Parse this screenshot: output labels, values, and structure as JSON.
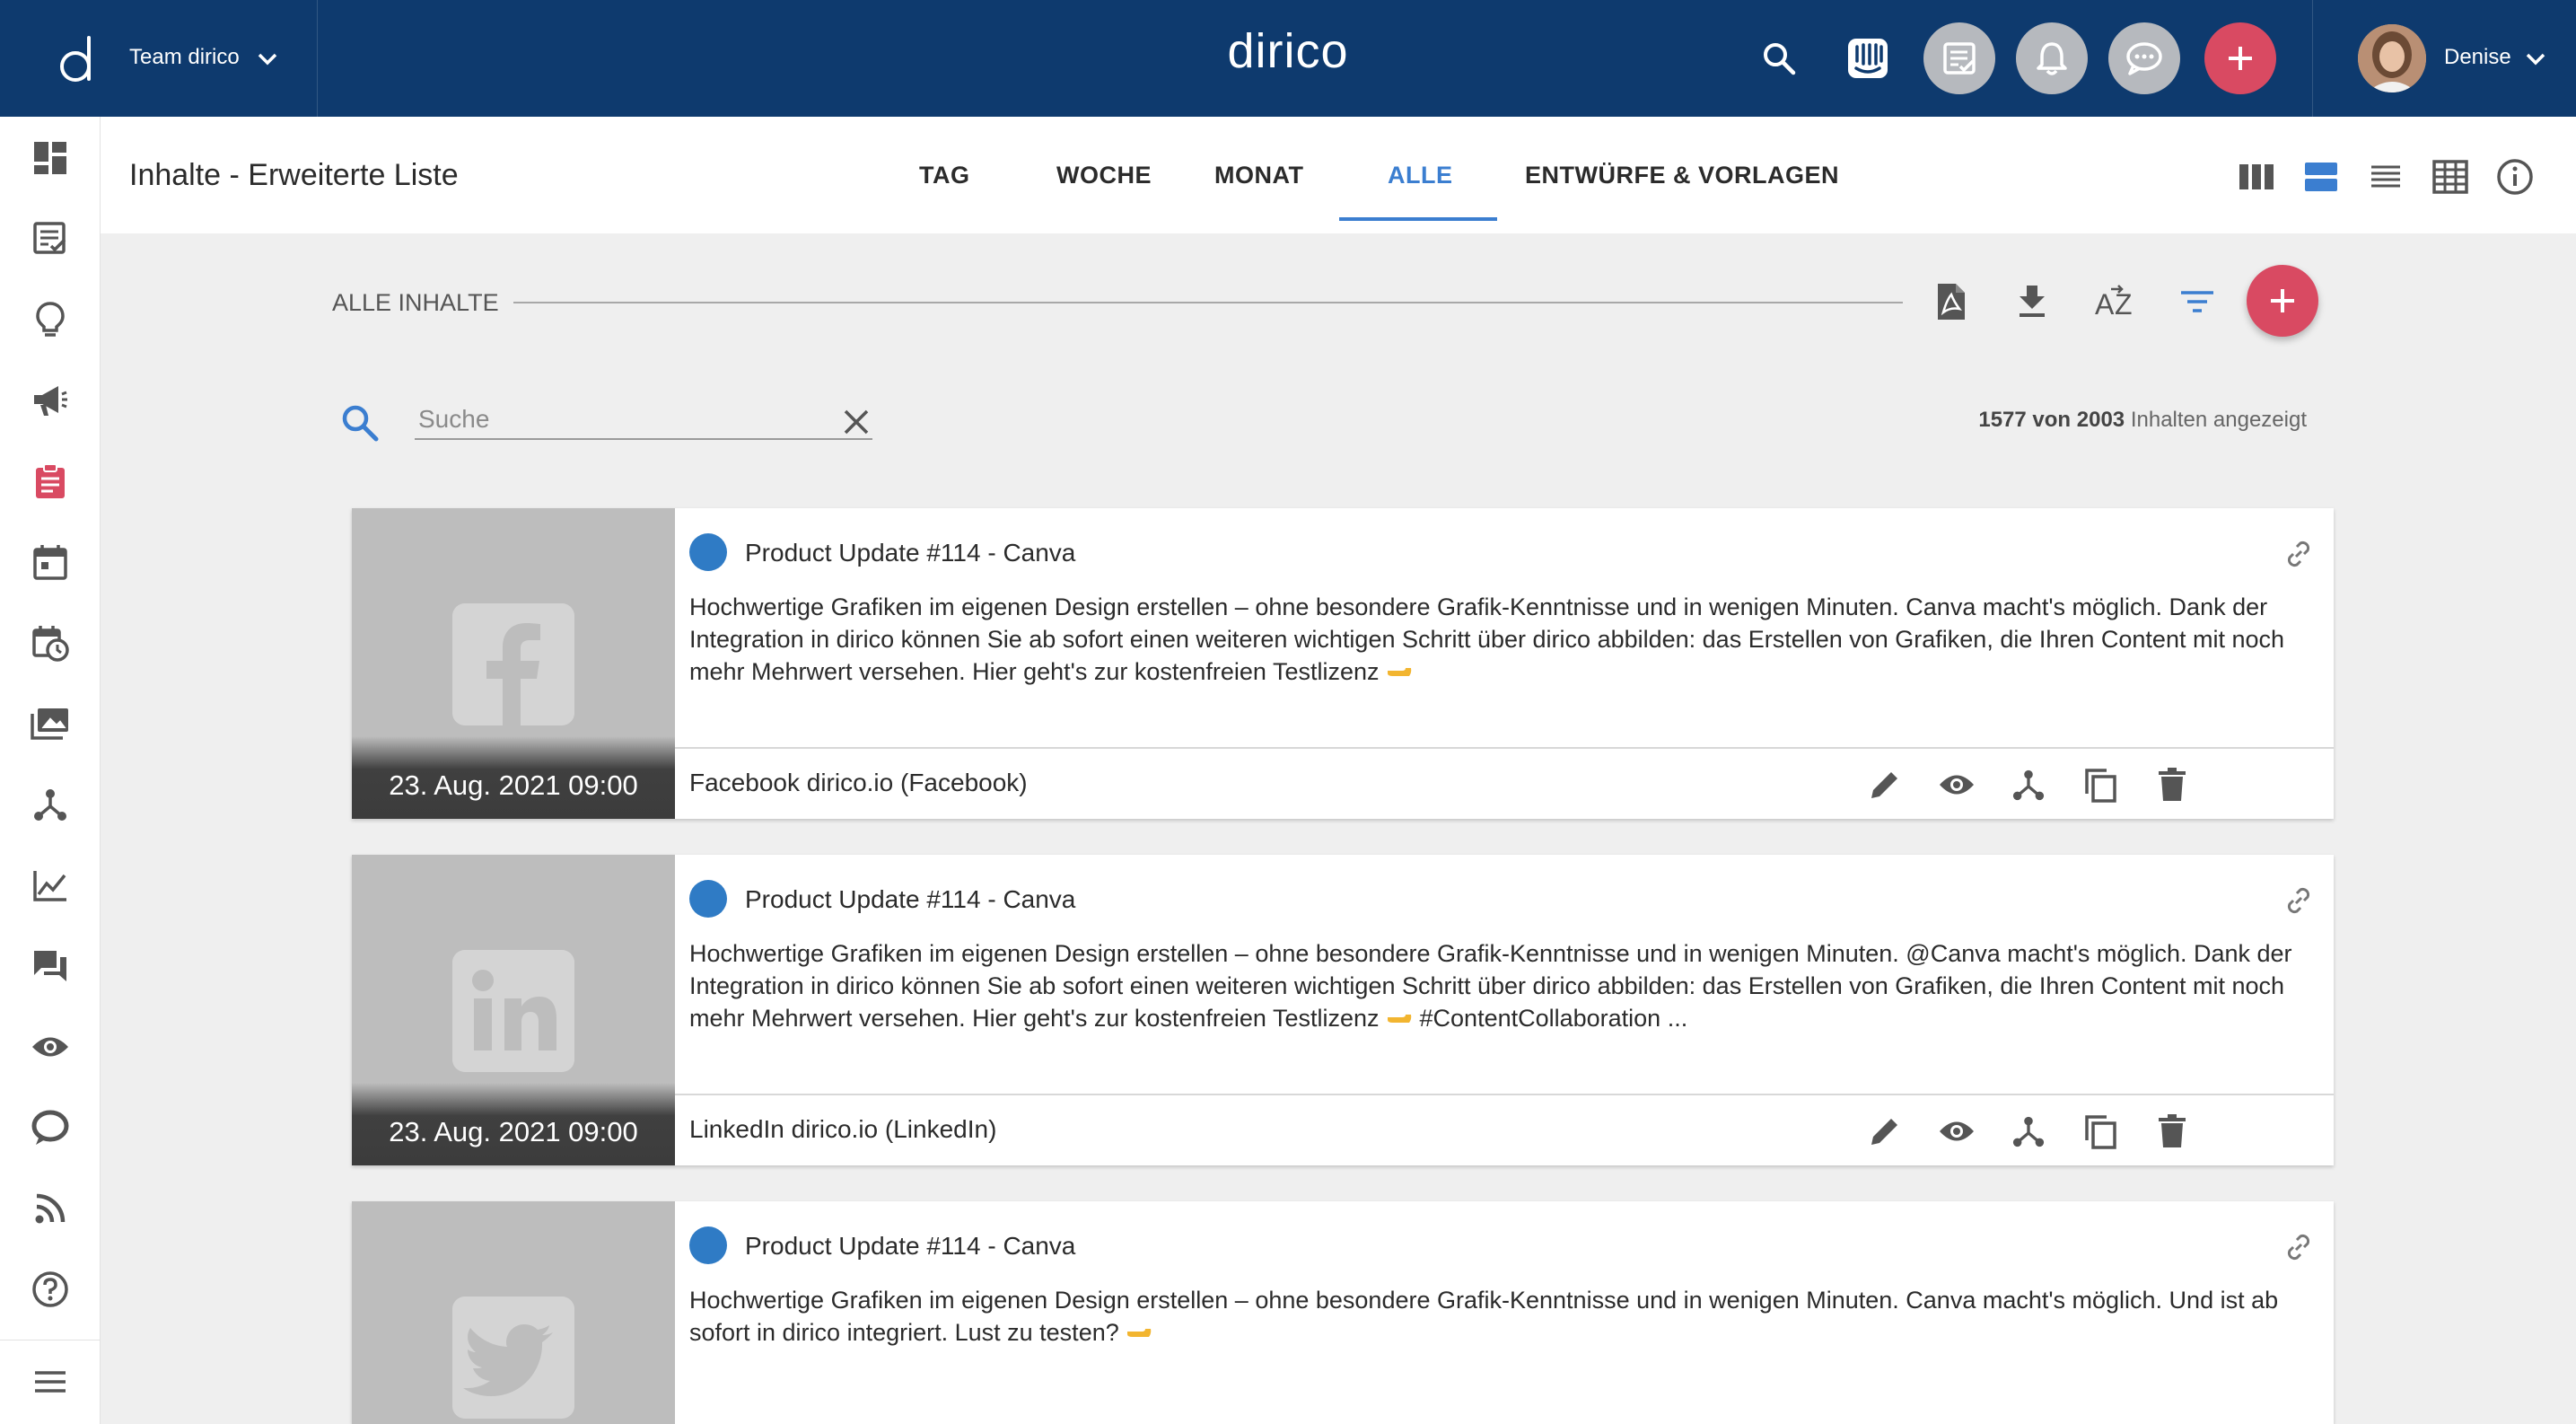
{
  "header": {
    "team_name": "Team dirico",
    "brand": "dirico",
    "user_name": "Denise"
  },
  "sidebar": {
    "items": [
      {
        "icon": "dashboard-icon"
      },
      {
        "icon": "tasks-icon"
      },
      {
        "icon": "lightbulb-icon"
      },
      {
        "icon": "megaphone-icon"
      },
      {
        "icon": "clipboard-icon",
        "active": true
      },
      {
        "icon": "calendar-icon"
      },
      {
        "icon": "calendar-clock-icon"
      },
      {
        "icon": "media-library-icon"
      },
      {
        "icon": "network-icon"
      },
      {
        "icon": "analytics-icon"
      },
      {
        "icon": "chat-icon"
      },
      {
        "icon": "eye-icon"
      },
      {
        "icon": "comment-icon"
      },
      {
        "icon": "rss-icon"
      },
      {
        "icon": "help-icon"
      },
      {
        "icon": "menu-icon"
      }
    ]
  },
  "subheader": {
    "title": "Inhalte - Erweiterte Liste",
    "tabs": [
      {
        "label": "TAG"
      },
      {
        "label": "WOCHE"
      },
      {
        "label": "MONAT"
      },
      {
        "label": "ALLE",
        "active": true
      },
      {
        "label": "ENTWÜRFE & VORLAGEN"
      }
    ]
  },
  "section": {
    "label": "ALLE INHALTE"
  },
  "search": {
    "placeholder": "Suche",
    "value": ""
  },
  "counts": {
    "shown": "1577",
    "word_of": "von",
    "total": "2003",
    "suffix": "Inhalten angezeigt"
  },
  "colors": {
    "header_bg": "#0e3a6e",
    "accent": "#3b7ed0",
    "fab": "#d94a62",
    "status_blue": "#2f7bc5"
  },
  "cards": [
    {
      "network": "facebook",
      "date": "23. Aug. 2021 09:00",
      "title": "Product Update #114 - Canva",
      "text": "Hochwertige Grafiken im eigenen Design erstellen – ohne besondere Grafik-Kenntnisse und in wenigen Minuten. Canva macht's möglich.  Dank der Integration in dirico können Sie ab sofort einen weiteren wichtigen Schritt über dirico abbilden: das Erstellen von Grafiken, die Ihren Content mit noch mehr Mehrwert versehen. Hier geht's zur kostenfreien Testlizenz",
      "channel": "Facebook dirico.io  (Facebook)"
    },
    {
      "network": "linkedin",
      "date": "23. Aug. 2021 09:00",
      "title": "Product Update #114 - Canva",
      "text": "Hochwertige Grafiken im eigenen Design erstellen – ohne besondere Grafik-Kenntnisse und in wenigen Minuten. @Canva macht's möglich.  Dank der Integration in dirico können Sie ab sofort einen weiteren wichtigen Schritt über dirico abbilden: das Erstellen von Grafiken, die Ihren Content mit noch mehr Mehrwert versehen. Hier geht's zur kostenfreien Testlizenz",
      "text_tail": "  #ContentCollaboration ...",
      "channel": "LinkedIn dirico.io  (LinkedIn)"
    },
    {
      "network": "twitter",
      "date": "",
      "title": "Product Update #114 - Canva",
      "text": "Hochwertige Grafiken im eigenen Design erstellen – ohne besondere Grafik-Kenntnisse und in wenigen Minuten. Canva macht's möglich. Und ist ab sofort in dirico integriert. Lust zu testen?",
      "channel": ""
    }
  ]
}
